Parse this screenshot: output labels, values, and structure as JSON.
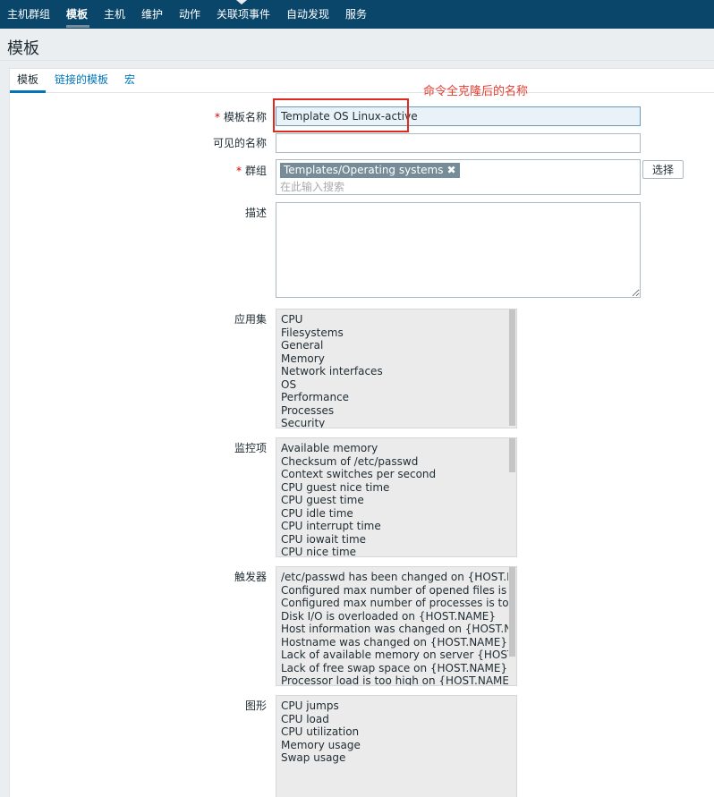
{
  "nav": {
    "items": [
      "主机群组",
      "模板",
      "主机",
      "维护",
      "动作",
      "关联项事件",
      "自动发现",
      "服务"
    ],
    "active_index": 1
  },
  "page": {
    "title": "模板"
  },
  "tabs": [
    "模板",
    "链接的模板",
    "宏"
  ],
  "annotation": "命令全克隆后的名称",
  "form": {
    "template_name_label": "模板名称",
    "template_name_value": "Template OS Linux-active",
    "visible_name_label": "可见的名称",
    "visible_name_value": "",
    "groups_label": "群组",
    "group_chip": "Templates/Operating systems",
    "group_chip_remove": "✖",
    "groups_search_placeholder": "在此输入搜索",
    "select_button": "选择",
    "description_label": "描述",
    "required_mark": "*"
  },
  "applications": {
    "label": "应用集",
    "items": [
      "CPU",
      "Filesystems",
      "General",
      "Memory",
      "Network interfaces",
      "OS",
      "Performance",
      "Processes",
      "Security"
    ]
  },
  "items": {
    "label": "监控项",
    "items": [
      "Available memory",
      "Checksum of /etc/passwd",
      "Context switches per second",
      "CPU guest nice time",
      "CPU guest time",
      "CPU idle time",
      "CPU interrupt time",
      "CPU iowait time",
      "CPU nice time"
    ]
  },
  "triggers": {
    "label": "触发器",
    "items": [
      "/etc/passwd has been changed on {HOST.NAME}",
      "Configured max number of opened files is too low on {HOST.NAME}",
      "Configured max number of processes is too low on {HOST.NAME}",
      "Disk I/O is overloaded on {HOST.NAME}",
      "Host information was changed on {HOST.NAME}",
      "Hostname was changed on {HOST.NAME}",
      "Lack of available memory on server {HOST.NAME}",
      "Lack of free swap space on {HOST.NAME}",
      "Processor load is too high on {HOST.NAME}"
    ]
  },
  "graphs": {
    "label": "图形",
    "items": [
      "CPU jumps",
      "CPU load",
      "CPU utilization",
      "Memory usage",
      "Swap usage"
    ]
  }
}
